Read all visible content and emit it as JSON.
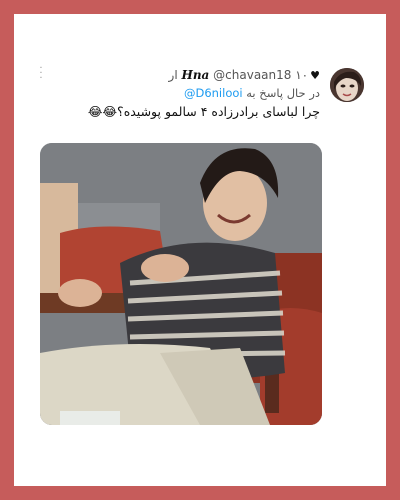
{
  "tweet": {
    "author_name": "Hna",
    "verified_icon": "heart-icon",
    "handle": "@chavaan18",
    "time": "۱۰ ار",
    "reply_prefix": "در حال پاسخ به",
    "reply_mention": "@D6nilooi",
    "text": "چرا لباسای برادرزاده ۴ سالمو پوشیده؟😂😂",
    "more_icon": "more-vertical-icon"
  },
  "colors": {
    "frame": "#c65c5b",
    "mention": "#1d9bf0"
  }
}
